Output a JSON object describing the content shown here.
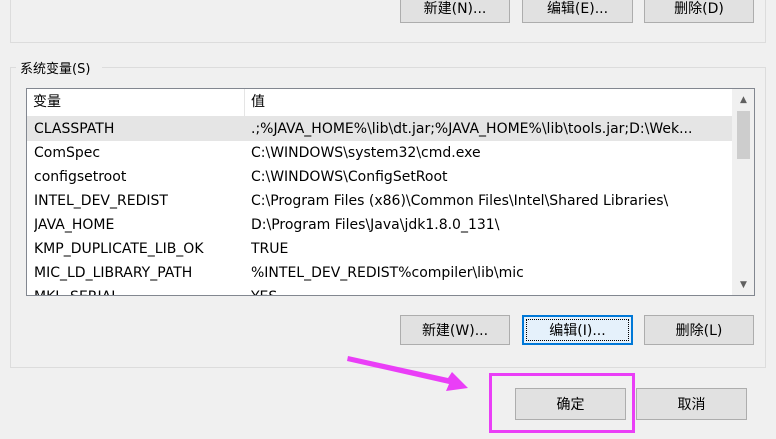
{
  "upper_buttons": {
    "new_label": "新建(N)...",
    "edit_label": "编辑(E)...",
    "delete_label": "删除(D)"
  },
  "system_vars": {
    "group_title": "系统变量(S)",
    "columns": {
      "variable": "变量",
      "value": "值"
    },
    "rows": [
      {
        "name": "CLASSPATH",
        "value": ".;%JAVA_HOME%\\lib\\dt.jar;%JAVA_HOME%\\lib\\tools.jar;D:\\Wek...",
        "selected": true
      },
      {
        "name": "ComSpec",
        "value": "C:\\WINDOWS\\system32\\cmd.exe",
        "selected": false
      },
      {
        "name": "configsetroot",
        "value": "C:\\WINDOWS\\ConfigSetRoot",
        "selected": false
      },
      {
        "name": "INTEL_DEV_REDIST",
        "value": "C:\\Program Files (x86)\\Common Files\\Intel\\Shared Libraries\\",
        "selected": false
      },
      {
        "name": "JAVA_HOME",
        "value": "D:\\Program Files\\Java\\jdk1.8.0_131\\",
        "selected": false
      },
      {
        "name": "KMP_DUPLICATE_LIB_OK",
        "value": "TRUE",
        "selected": false
      },
      {
        "name": "MIC_LD_LIBRARY_PATH",
        "value": "%INTEL_DEV_REDIST%compiler\\lib\\mic",
        "selected": false
      },
      {
        "name": "MKL_SERIAL",
        "value": "YES",
        "selected": false
      }
    ],
    "new_label": "新建(W)...",
    "edit_label": "编辑(I)...",
    "delete_label": "删除(L)"
  },
  "dialog_buttons": {
    "ok_label": "确定",
    "cancel_label": "取消"
  },
  "annotation": {
    "color": "#ea3ef7"
  }
}
